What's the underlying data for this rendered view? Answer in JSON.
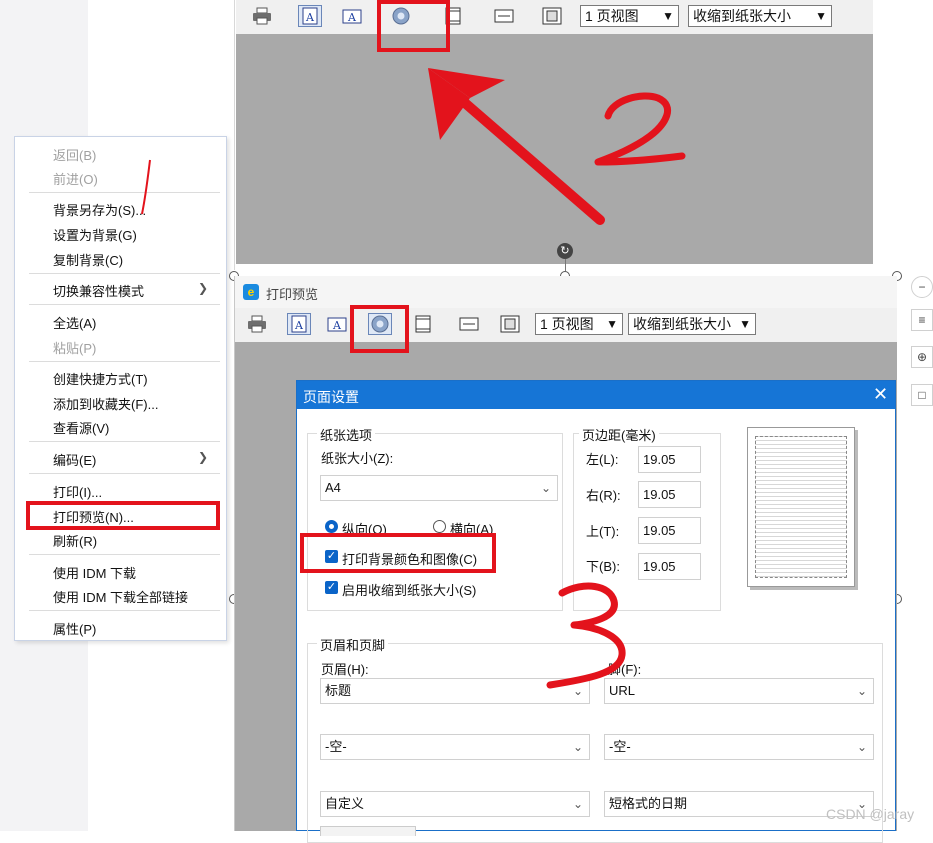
{
  "top_toolbar": {
    "view_select": "1 页视图",
    "zoom_select": "收缩到纸张大小"
  },
  "context_menu": {
    "items": [
      {
        "label": "返回(B)",
        "disabled": true
      },
      {
        "label": "前进(O)",
        "disabled": true
      },
      {
        "label": "背景另存为(S)...",
        "disabled": false
      },
      {
        "label": "设置为背景(G)",
        "disabled": false
      },
      {
        "label": "复制背景(C)",
        "disabled": false
      },
      {
        "label": "切换兼容性模式",
        "disabled": false,
        "submenu": true
      },
      {
        "label": "全选(A)",
        "disabled": false
      },
      {
        "label": "粘贴(P)",
        "disabled": true
      },
      {
        "label": "创建快捷方式(T)",
        "disabled": false
      },
      {
        "label": "添加到收藏夹(F)...",
        "disabled": false
      },
      {
        "label": "查看源(V)",
        "disabled": false
      },
      {
        "label": "编码(E)",
        "disabled": false,
        "submenu": true
      },
      {
        "label": "打印(I)...",
        "disabled": false
      },
      {
        "label": "打印预览(N)...",
        "disabled": false
      },
      {
        "label": "刷新(R)",
        "disabled": false
      },
      {
        "label": "使用 IDM 下载",
        "disabled": false
      },
      {
        "label": "使用 IDM 下载全部链接",
        "disabled": false
      },
      {
        "label": "属性(P)",
        "disabled": false
      }
    ]
  },
  "preview_window": {
    "title": "打印预览",
    "view_select": "1 页视图",
    "zoom_select": "收缩到纸张大小"
  },
  "page_setup": {
    "title": "页面设置",
    "paper_group_label": "纸张选项",
    "paper_size_label": "纸张大小(Z):",
    "paper_size_value": "A4",
    "portrait_label": "纵向(O)",
    "landscape_label": "横向(A)",
    "print_bg_label": "打印背景颜色和图像(C)",
    "shrink_label": "启用收缩到纸张大小(S)",
    "margins_group_label": "页边距(毫米)",
    "margin_left_label": "左(L):",
    "margin_left_value": "19.05",
    "margin_right_label": "右(R):",
    "margin_right_value": "19.05",
    "margin_top_label": "上(T):",
    "margin_top_value": "19.05",
    "margin_bottom_label": "下(B):",
    "margin_bottom_value": "19.05",
    "hf_group_label": "页眉和页脚",
    "header_label": "页眉(H):",
    "footer_label": "脚(F):",
    "header_1": "标题",
    "footer_1": "URL",
    "header_2": "-空-",
    "footer_2": "-空-",
    "header_3": "自定义",
    "footer_3": "短格式的日期"
  },
  "annotations": {
    "step_2": "2",
    "step_3": "3",
    "annotation_color": "#e3131c"
  },
  "watermark": "CSDN @jaray",
  "colors": {
    "dialog_title_bg": "#1675d6",
    "check_blue": "#0a64c8",
    "preview_gray": "#a9a9a9"
  }
}
